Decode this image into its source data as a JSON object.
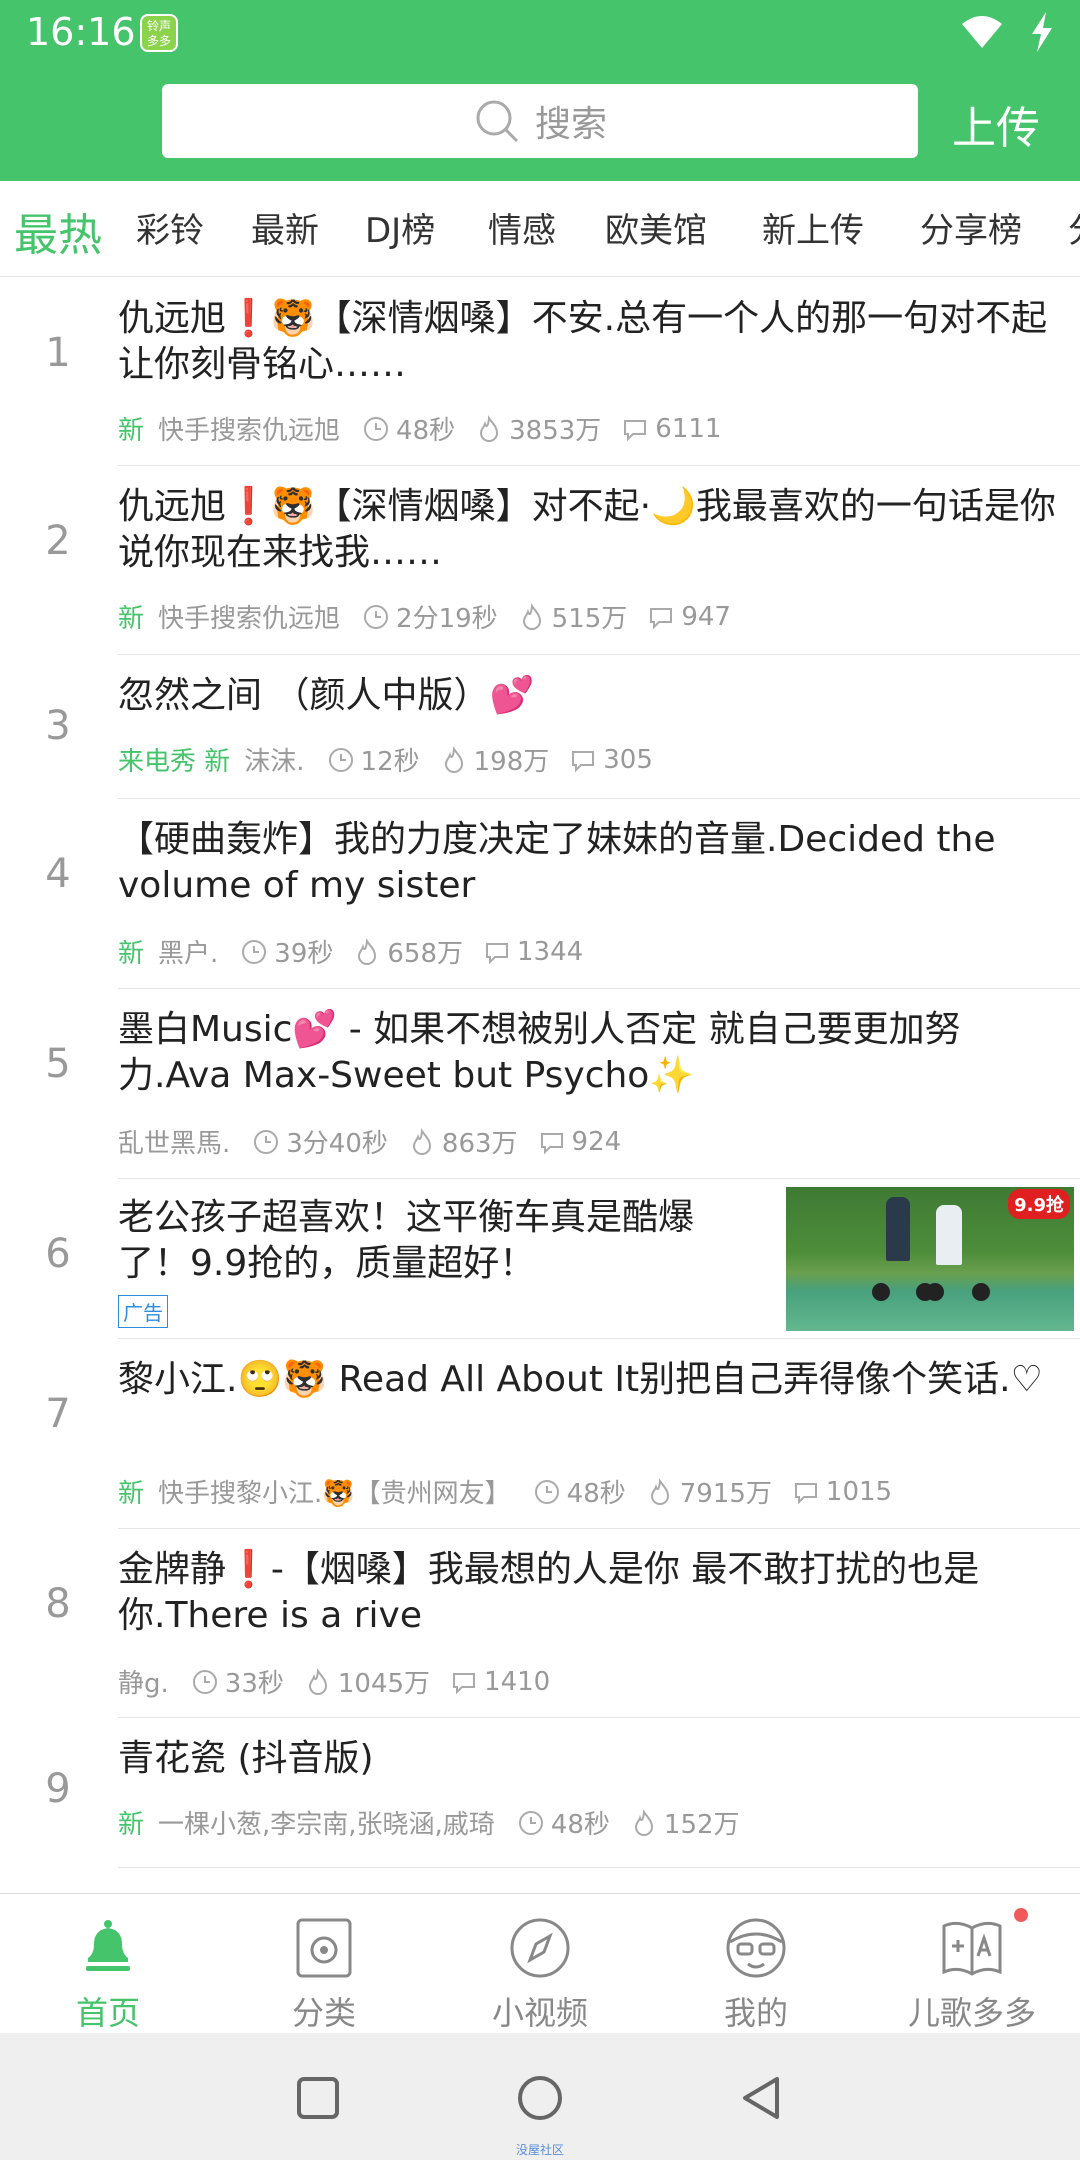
{
  "status_bar": {
    "time": "16:16",
    "app_badge": "铃声多多"
  },
  "header": {
    "search_placeholder": "搜索",
    "upload_label": "上传"
  },
  "tabs": [
    {
      "label": "最热",
      "active": true
    },
    {
      "label": "彩铃",
      "active": false
    },
    {
      "label": "最新",
      "active": false
    },
    {
      "label": "DJ榜",
      "active": false
    },
    {
      "label": "情感",
      "active": false
    },
    {
      "label": "欧美馆",
      "active": false
    },
    {
      "label": "新上传",
      "active": false
    },
    {
      "label": "分享榜",
      "active": false
    }
  ],
  "songs": [
    {
      "rank": "1",
      "title": "仇远旭❗🐯【深情烟嗓】不安.总有一个人的那一句对不起 让你刻骨铭心……",
      "tags": "新",
      "author": "快手搜索仇远旭",
      "duration": "48秒",
      "plays": "3853万",
      "comments": "6111"
    },
    {
      "rank": "2",
      "title": "仇远旭❗🐯【深情烟嗓】对不起·🌙我最喜欢的一句话是你说你现在来找我……",
      "tags": "新",
      "author": "快手搜索仇远旭",
      "duration": "2分19秒",
      "plays": "515万",
      "comments": "947"
    },
    {
      "rank": "3",
      "title": "忽然之间 （颜人中版）💕",
      "tags": "来电秀 新",
      "author": "沫沫.",
      "duration": "12秒",
      "plays": "198万",
      "comments": "305"
    },
    {
      "rank": "4",
      "title": "【硬曲轰炸】我的力度决定了妹妹的音量.Decided the volume of my sister",
      "tags": "新",
      "author": "黑户.",
      "duration": "39秒",
      "plays": "658万",
      "comments": "1344"
    },
    {
      "rank": "5",
      "title": "墨白Music💕 - 如果不想被别人否定 就自己要更加努力.Ava Max-Sweet but Psycho✨",
      "tags": "",
      "author": "乱世黑馬.",
      "duration": "3分40秒",
      "plays": "863万",
      "comments": "924"
    },
    {
      "rank": "6",
      "title": "老公孩子超喜欢！这平衡车真是酷爆了！9.9抢的，质量超好！",
      "ad_label": "广告",
      "ad_badge": "9.9抢"
    },
    {
      "rank": "7",
      "title": "黎小江.🙄🐯 Read All About It别把自己弄得像个笑话.♡",
      "tags": "新",
      "author": "快手搜黎小江.🐯【贵州网友】",
      "duration": "48秒",
      "plays": "7915万",
      "comments": "1015"
    },
    {
      "rank": "8",
      "title": "金牌静❗-【烟嗓】我最想的人是你 最不敢打扰的也是你.There is a rive",
      "tags": "",
      "author": "静g.",
      "duration": "33秒",
      "plays": "1045万",
      "comments": "1410"
    },
    {
      "rank": "9",
      "title": "青花瓷 (抖音版)",
      "tags": "新",
      "author": "一棵小葱,李宗南,张晓涵,戚琦",
      "duration": "48秒",
      "plays": "152万",
      "comments": ""
    }
  ],
  "bottom_nav": [
    {
      "label": "首页",
      "icon": "bell-icon",
      "active": true
    },
    {
      "label": "分类",
      "icon": "speaker-icon",
      "active": false
    },
    {
      "label": "小视频",
      "icon": "compass-icon",
      "active": false
    },
    {
      "label": "我的",
      "icon": "face-glasses-icon",
      "active": false
    },
    {
      "label": "儿歌多多",
      "icon": "book-icon",
      "active": false
    }
  ],
  "watermark": "没屋社区",
  "colors": {
    "accent": "#45c46b",
    "meta_gray": "#999999",
    "ad_blue": "#2d8ee0"
  }
}
